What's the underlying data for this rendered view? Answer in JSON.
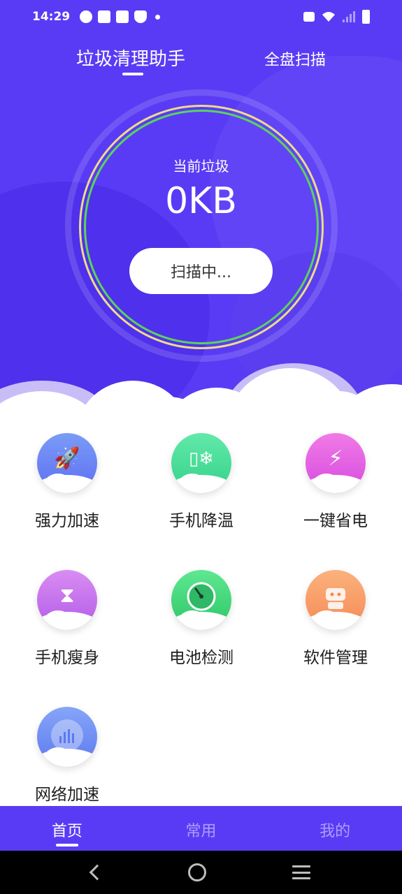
{
  "status_bar": {
    "time": "14:29",
    "icons": [
      "timer-icon",
      "mail-icon",
      "mail-icon",
      "shield-icon",
      "dot-icon",
      "vibrate-icon",
      "wifi-icon",
      "signal-icon",
      "battery-icon"
    ]
  },
  "header": {
    "tab_clean": "垃圾清理助手",
    "tab_full_scan": "全盘扫描"
  },
  "junk": {
    "label": "当前垃圾",
    "value": "0KB",
    "scan_button": "扫描中..."
  },
  "features": [
    {
      "label": "强力加速",
      "icon": "rocket-icon",
      "color_top": "#7a9cf7",
      "color_bottom": "#5e6ef2"
    },
    {
      "label": "手机降温",
      "icon": "phone-cool-icon",
      "color_top": "#62e9a9",
      "color_bottom": "#34d18a"
    },
    {
      "label": "一键省电",
      "icon": "power-save-icon",
      "color_top": "#f07ae6",
      "color_bottom": "#d64bdf"
    },
    {
      "label": "手机瘦身",
      "icon": "slim-icon",
      "color_top": "#d98df2",
      "color_bottom": "#b25ae8"
    },
    {
      "label": "电池检测",
      "icon": "battery-gauge-icon",
      "color_top": "#5fe891",
      "color_bottom": "#2cc567"
    },
    {
      "label": "软件管理",
      "icon": "robot-icon",
      "color_top": "#fbb27d",
      "color_bottom": "#f58a55"
    },
    {
      "label": "网络加速",
      "icon": "network-bars-icon",
      "color_top": "#86a5f8",
      "color_bottom": "#5d79f0"
    }
  ],
  "bottom_nav": {
    "home": "首页",
    "common": "常用",
    "mine": "我的"
  },
  "colors": {
    "primary": "#5a3bf5",
    "ring_yellow": "#ecdb8a",
    "ring_green": "#5bd35b"
  }
}
